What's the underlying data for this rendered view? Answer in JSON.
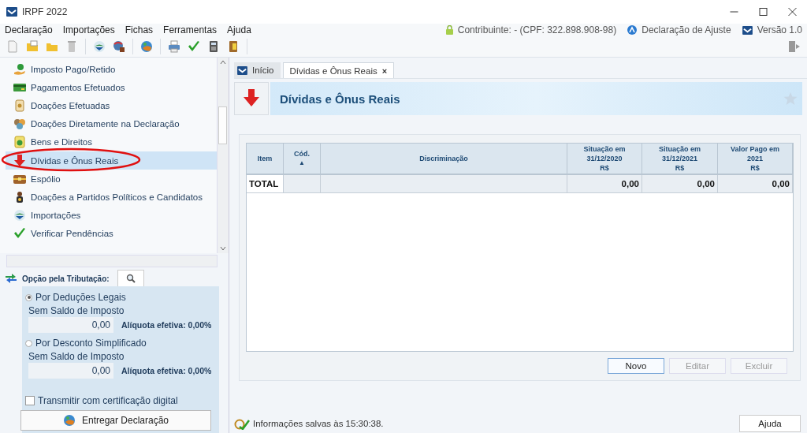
{
  "window": {
    "title": "IRPF 2022"
  },
  "menu": [
    "Declaração",
    "Importações",
    "Fichas",
    "Ferramentas",
    "Ajuda"
  ],
  "header_info": {
    "taxpayer": "Contribuinte:  - (CPF: 322.898.908-98)",
    "declaration_type": "Declaração de Ajuste",
    "version": "Versão 1.0"
  },
  "sidebar": {
    "items": [
      {
        "label": "Imposto Pago/Retido",
        "selected": false
      },
      {
        "label": "Pagamentos Efetuados",
        "selected": false
      },
      {
        "label": "Doações Efetuadas",
        "selected": false
      },
      {
        "label": "Doações Diretamente na Declaração",
        "selected": false
      },
      {
        "label": "Bens e Direitos",
        "selected": false
      },
      {
        "label": "Dívidas e Ônus Reais",
        "selected": true
      },
      {
        "label": "Espólio",
        "selected": false
      },
      {
        "label": "Doações a Partidos Políticos e Candidatos",
        "selected": false
      },
      {
        "label": "Importações",
        "selected": false
      },
      {
        "label": "Verificar Pendências",
        "selected": false
      }
    ]
  },
  "tax_option": {
    "label": "Opção pela Tributação:",
    "options": [
      {
        "label": "Por Deduções Legais",
        "selected": true,
        "sublabel": "Sem Saldo de Imposto",
        "value": "0,00",
        "rate": "Alíquota efetiva: 0,00%"
      },
      {
        "label": "Por Desconto Simplificado",
        "selected": false,
        "sublabel": "Sem Saldo de Imposto",
        "value": "0,00",
        "rate": "Alíquota efetiva: 0,00%"
      }
    ],
    "certificate": {
      "label": "Transmitir com certificação digital",
      "checked": false
    },
    "submit_button": "Entregar Declaração"
  },
  "tabs": [
    {
      "label": "Início",
      "selected": false
    },
    {
      "label": "Dívidas e Ônus Reais",
      "selected": true,
      "close": "×"
    }
  ],
  "page_title": "Dívidas e Ônus Reais",
  "table": {
    "columns": [
      {
        "lines": [
          "Item"
        ]
      },
      {
        "lines": [
          "Cód."
        ],
        "sort_indicator": "▲"
      },
      {
        "lines": [
          "Discriminação"
        ]
      },
      {
        "lines": [
          "Situação em",
          "31/12/2020",
          "R$"
        ]
      },
      {
        "lines": [
          "Situação em",
          "31/12/2021",
          "R$"
        ]
      },
      {
        "lines": [
          "Valor Pago em",
          "2021",
          "R$"
        ]
      }
    ],
    "total_row": {
      "label": "TOTAL",
      "values": [
        "0,00",
        "0,00",
        "0,00"
      ]
    }
  },
  "buttons": [
    {
      "label": "Novo",
      "disabled": false
    },
    {
      "label": "Editar",
      "disabled": true
    },
    {
      "label": "Excluir",
      "disabled": true
    }
  ],
  "status": "Informações salvas às 15:30:38.",
  "help_button": "Ajuda"
}
